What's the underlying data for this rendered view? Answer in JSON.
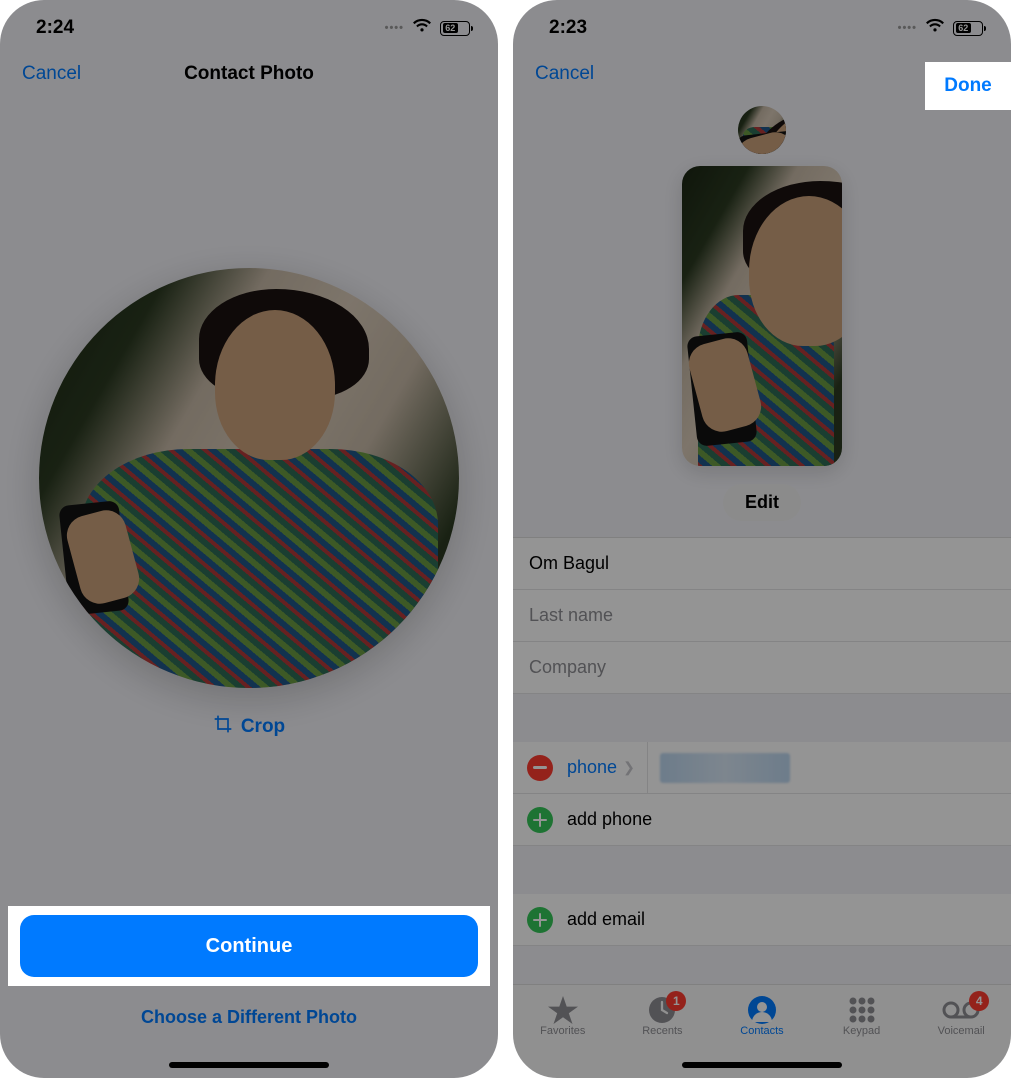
{
  "left": {
    "status": {
      "time": "2:24",
      "battery_pct": "62"
    },
    "nav": {
      "cancel": "Cancel",
      "title": "Contact Photo"
    },
    "crop_label": "Crop",
    "continue_label": "Continue",
    "choose_different": "Choose a Different Photo"
  },
  "right": {
    "status": {
      "time": "2:23",
      "battery_pct": "62"
    },
    "nav": {
      "cancel": "Cancel",
      "done": "Done"
    },
    "edit_label": "Edit",
    "fields": {
      "first_name_value": "Om Bagul",
      "last_name_placeholder": "Last name",
      "company_placeholder": "Company"
    },
    "phone_row": {
      "label": "phone"
    },
    "add_phone": "add phone",
    "add_email": "add email",
    "tabs": {
      "favorites": "Favorites",
      "recents": "Recents",
      "contacts": "Contacts",
      "keypad": "Keypad",
      "voicemail": "Voicemail",
      "recents_badge": "1",
      "voicemail_badge": "4"
    }
  }
}
